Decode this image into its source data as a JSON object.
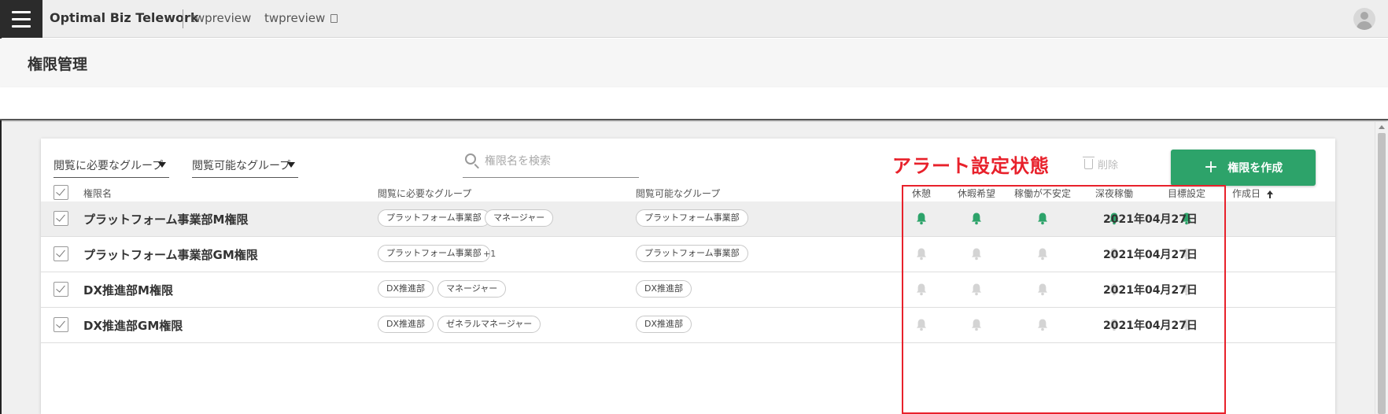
{
  "topbar": {
    "app_title": "Optimal Biz Telework",
    "tenant": "twpreview",
    "user": "twpreview"
  },
  "page": {
    "title": "権限管理"
  },
  "toolbar": {
    "filter_required_group": "閲覧に必要なグループ",
    "filter_viewable_group": "閲覧可能なグループ",
    "search_placeholder": "権限名を検索",
    "annotation": "アラート設定状態",
    "delete_label": "削除",
    "create_label": "権限を作成",
    "create_icon": "+"
  },
  "table": {
    "headers": {
      "name": "権限名",
      "required_group": "閲覧に必要なグループ",
      "viewable_group": "閲覧可能なグループ",
      "alerts": [
        "休憩",
        "休暇希望",
        "稼働が不安定",
        "深夜稼働",
        "目標設定"
      ],
      "created": "作成日"
    },
    "rows": [
      {
        "name": "プラットフォーム事業部M権限",
        "required_groups": [
          "プラットフォーム事業部",
          "マネージャー"
        ],
        "required_more": "",
        "viewable_groups": [
          "プラットフォーム事業部"
        ],
        "alerts_on": true,
        "created": "2021年04月27日"
      },
      {
        "name": "プラットフォーム事業部GM権限",
        "required_groups": [
          "プラットフォーム事業部"
        ],
        "required_more": "+1",
        "viewable_groups": [
          "プラットフォーム事業部"
        ],
        "alerts_on": false,
        "created": "2021年04月27日"
      },
      {
        "name": "DX推進部M権限",
        "required_groups": [
          "DX推進部",
          "マネージャー"
        ],
        "required_more": "",
        "viewable_groups": [
          "DX推進部"
        ],
        "alerts_on": false,
        "created": "2021年04月27日"
      },
      {
        "name": "DX推進部GM権限",
        "required_groups": [
          "DX推進部",
          "ゼネラルマネージャー"
        ],
        "required_more": "",
        "viewable_groups": [
          "DX推進部"
        ],
        "alerts_on": false,
        "created": "2021年04月27日"
      }
    ]
  },
  "colors": {
    "bell_on": "#2da36a",
    "bell_off": "#d4d4d4",
    "annotation": "#e8212b",
    "primary_button": "#2da36a"
  },
  "icons": {
    "menu": "hamburger-icon",
    "copy": "copy-icon",
    "avatar": "user-avatar-icon",
    "search": "search-icon",
    "delete": "trash-icon",
    "create": "plus-icon",
    "alert": "bell-icon",
    "sort": "sort-ascending-icon"
  }
}
